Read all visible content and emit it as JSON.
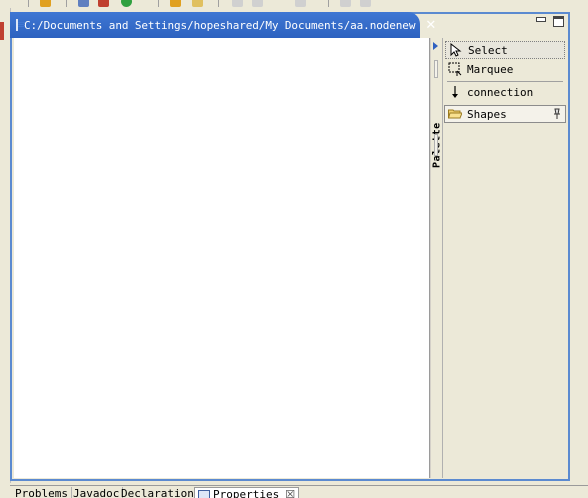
{
  "editor": {
    "tab_title": "C:/Documents and Settings/hopeshared/My Documents/aa.nodenew",
    "close_glyph": "✕"
  },
  "palette": {
    "label": "Palette",
    "items": [
      {
        "label": "Select",
        "icon": "arrow-cursor-icon",
        "selected": true
      },
      {
        "label": "Marquee",
        "icon": "marquee-icon",
        "selected": false
      },
      {
        "label": "connection",
        "icon": "connection-arrow-icon",
        "selected": false
      }
    ],
    "drawer": {
      "label": "Shapes",
      "icon": "folder-open-icon",
      "pin_icon": "pin-icon"
    }
  },
  "bottom_tabs": [
    {
      "label": "Problems"
    },
    {
      "label": "Javadoc"
    },
    {
      "label": "Declaration"
    },
    {
      "label": "Properties",
      "active": true,
      "close_glyph": "☒"
    }
  ],
  "colors": {
    "tab_active": "#3f77d3",
    "frame_border": "#5b8ad0",
    "canvas": "#ffffff",
    "chrome": "#ece9d8"
  }
}
